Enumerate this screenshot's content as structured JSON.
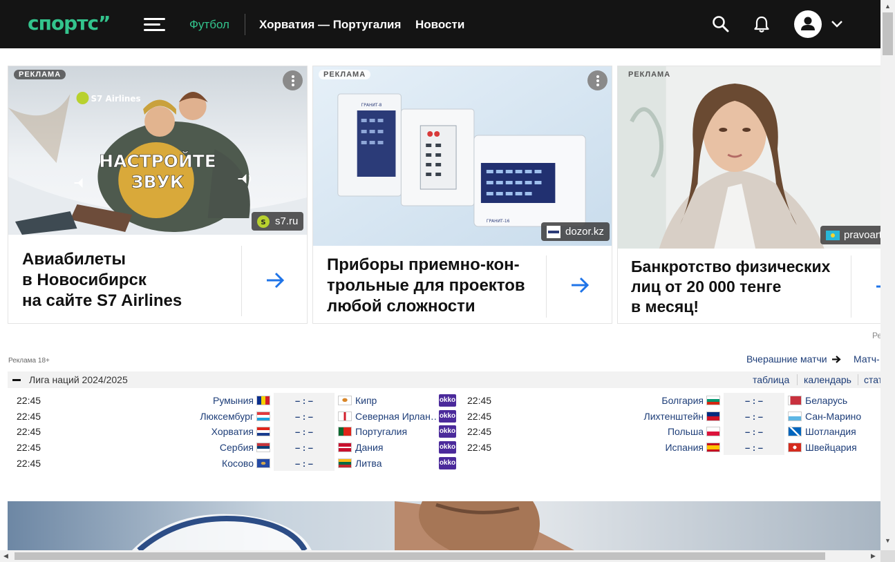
{
  "header": {
    "logo": "спортс”",
    "nav": [
      "Футбол",
      "Хорватия — Португалия",
      "Новости"
    ],
    "icons": [
      "menu-icon",
      "search-icon",
      "bell-icon",
      "user-icon",
      "chevron-down-icon"
    ],
    "colors": {
      "bg": "#141414",
      "accent": "#33c48d"
    }
  },
  "ads": [
    {
      "tag": "РЕКЛАМА",
      "brand": "S7 Airlines",
      "banner_text": [
        "НАСТРОЙТЕ",
        "ЗВУК"
      ],
      "source": "s7.ru",
      "title": [
        "Авиабилеты",
        "в Новосибирск",
        "на сайте S7 Airlines"
      ]
    },
    {
      "tag": "РЕКЛАМА",
      "source": "dozor.kz",
      "device_labels": [
        "ГРАНИТ-8",
        "ГРАНИТ-16"
      ],
      "title": [
        "Приборы приемно-кон-",
        "трольные для проектов",
        "любой сложности"
      ]
    },
    {
      "tag": "РЕКЛАМА",
      "source": "pravoarti",
      "title": [
        "Банкротство физических",
        "лиц от 20 000 тенге",
        "в месяц!"
      ]
    }
  ],
  "ads_footer": "Ре",
  "fixtures": {
    "ad_label": "Реклама 18+",
    "yesterday_link": "Вчерашние матчи",
    "matches_link": "Матч-",
    "league": {
      "title": "Лига наций 2024/2025",
      "links": [
        "таблица",
        "календарь",
        "стат"
      ]
    },
    "score_placeholder": "– : –",
    "broadcaster": "okko",
    "columns": [
      [
        {
          "time": "22:45",
          "home": "Румыния",
          "away": "Кипр",
          "home_flag": "romania",
          "away_flag": "cyprus"
        },
        {
          "time": "22:45",
          "home": "Люксембург",
          "away": "Северная Ирлан…",
          "home_flag": "luxembourg",
          "away_flag": "northern-ireland"
        },
        {
          "time": "22:45",
          "home": "Хорватия",
          "away": "Португалия",
          "home_flag": "croatia",
          "away_flag": "portugal"
        },
        {
          "time": "22:45",
          "home": "Сербия",
          "away": "Дания",
          "home_flag": "serbia",
          "away_flag": "denmark"
        },
        {
          "time": "22:45",
          "home": "Косово",
          "away": "Литва",
          "home_flag": "kosovo",
          "away_flag": "lithuania"
        }
      ],
      [
        {
          "time": "22:45",
          "home": "Болгария",
          "away": "Беларусь",
          "home_flag": "bulgaria",
          "away_flag": "belarus"
        },
        {
          "time": "22:45",
          "home": "Лихтенштейн",
          "away": "Сан-Марино",
          "home_flag": "liechtenstein",
          "away_flag": "san-marino"
        },
        {
          "time": "22:45",
          "home": "Польша",
          "away": "Шотландия",
          "home_flag": "poland",
          "away_flag": "scotland"
        },
        {
          "time": "22:45",
          "home": "Испания",
          "away": "Швейцария",
          "home_flag": "spain",
          "away_flag": "switzerland"
        }
      ]
    ]
  }
}
